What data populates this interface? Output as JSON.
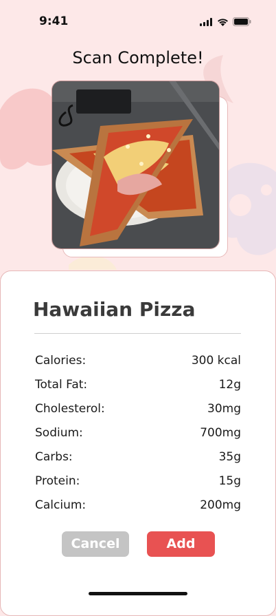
{
  "status_bar": {
    "time": "9:41"
  },
  "screen": {
    "title": "Scan Complete!"
  },
  "result": {
    "food_name": "Hawaiian Pizza",
    "nutrients": [
      {
        "label": "Calories:",
        "value": "300 kcal"
      },
      {
        "label": "Total Fat:",
        "value": "12g"
      },
      {
        "label": "Cholesterol:",
        "value": "30mg"
      },
      {
        "label": "Sodium:",
        "value": "700mg"
      },
      {
        "label": "Carbs:",
        "value": "35g"
      },
      {
        "label": "Protein:",
        "value": "15g"
      },
      {
        "label": "Calcium:",
        "value": "200mg"
      }
    ]
  },
  "actions": {
    "cancel_label": "Cancel",
    "add_label": "Add"
  },
  "colors": {
    "background": "#fde8e8",
    "accent": "#e85252",
    "cancel": "#c4c4c4"
  },
  "icons": [
    "cellular-signal-icon",
    "wifi-icon",
    "battery-icon"
  ]
}
